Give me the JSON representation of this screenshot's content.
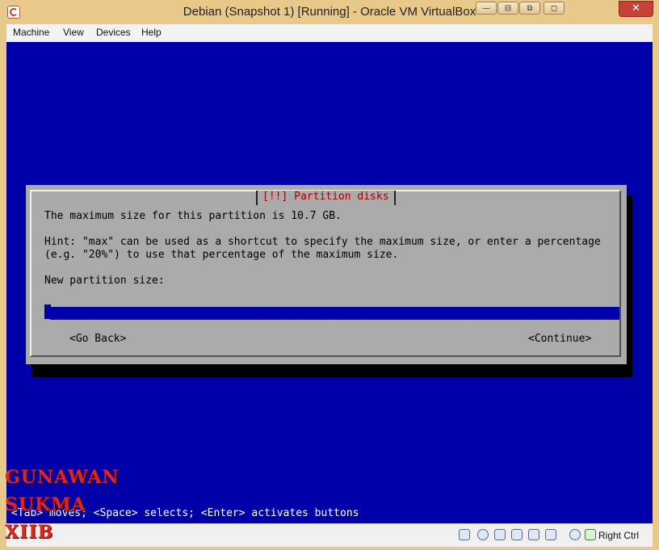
{
  "window": {
    "title": "Debian (Snapshot 1) [Running] - Oracle VM VirtualBox",
    "controls": {
      "close": "✕"
    }
  },
  "menu": {
    "items": [
      "Machine",
      "View",
      "Devices",
      "Help"
    ]
  },
  "dialog": {
    "title": "[!!] Partition disks",
    "message": "The maximum size for this partition is 10.7 GB.",
    "hint_line1": "Hint: \"max\" can be used as a shortcut to specify the maximum size, or enter a percentage",
    "hint_line2": "(e.g. \"20%\") to use that percentage of the maximum size.",
    "field_label": "New partition size:",
    "field_value": "",
    "go_back": "<Go Back>",
    "continue": "<Continue>"
  },
  "footer_hint": "<Tab> moves; <Space> selects; <Enter> activates buttons",
  "status": {
    "host_key": "Right Ctrl",
    "icons": [
      "hard-disk-icon",
      "optical-drive-icon",
      "usb-icon",
      "shared-folders-icon",
      "display-icon",
      "video-capture-icon",
      "network-icon",
      "mouse-integration-icon",
      "host-key-icon"
    ]
  },
  "watermark": {
    "line1": "GUNAWAN",
    "line2": "SUKMA",
    "line3": "XIIB"
  }
}
